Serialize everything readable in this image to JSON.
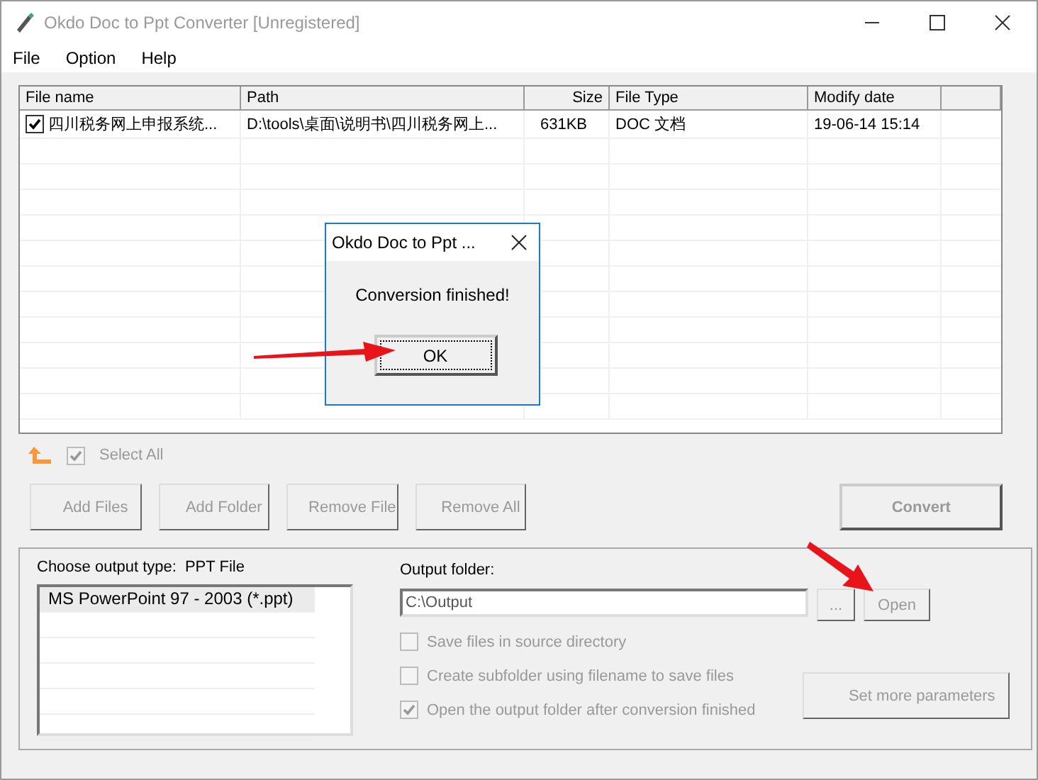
{
  "window": {
    "title": "Okdo Doc to Ppt Converter [Unregistered]"
  },
  "menu": [
    {
      "label": "File"
    },
    {
      "label": "Option"
    },
    {
      "label": "Help"
    }
  ],
  "table": {
    "columns": [
      {
        "label": "File name"
      },
      {
        "label": "Path"
      },
      {
        "label": "Size"
      },
      {
        "label": "File Type"
      },
      {
        "label": "Modify date"
      }
    ],
    "rows": [
      {
        "checked": true,
        "cells": [
          "四川税务网上申报系统...",
          "D:\\tools\\桌面\\说明书\\四川税务网上...",
          "631KB",
          "DOC 文档",
          "19-06-14 15:14"
        ]
      }
    ]
  },
  "select_all": {
    "label": "Select All",
    "checked": true,
    "disabled": true
  },
  "buttons": [
    {
      "label": "Add Files",
      "disabled": true
    },
    {
      "label": "Add Folder",
      "disabled": true
    },
    {
      "label": "Remove File",
      "disabled": true
    },
    {
      "label": "Remove All",
      "disabled": true
    }
  ],
  "convert_button": {
    "label": "Convert",
    "disabled": true
  },
  "output": {
    "type_label": "Choose output type:",
    "type_value": "PPT File",
    "types": [
      {
        "label": "MS PowerPoint 97 - 2003 (*.ppt)",
        "selected": true
      }
    ],
    "folder_label": "Output folder:",
    "folder_value": "C:\\Output",
    "browse_label": "...",
    "open_label": "Open",
    "options": [
      {
        "label": "Save files in source directory",
        "checked": false,
        "disabled": true
      },
      {
        "label": "Create subfolder using filename to save files",
        "checked": false,
        "disabled": true
      },
      {
        "label": "Open the output folder after conversion finished",
        "checked": true,
        "disabled": true
      }
    ],
    "params_button": "Set more parameters"
  },
  "dialog": {
    "title": "Okdo Doc to Ppt ...",
    "message": "Conversion finished!",
    "ok": "OK"
  }
}
